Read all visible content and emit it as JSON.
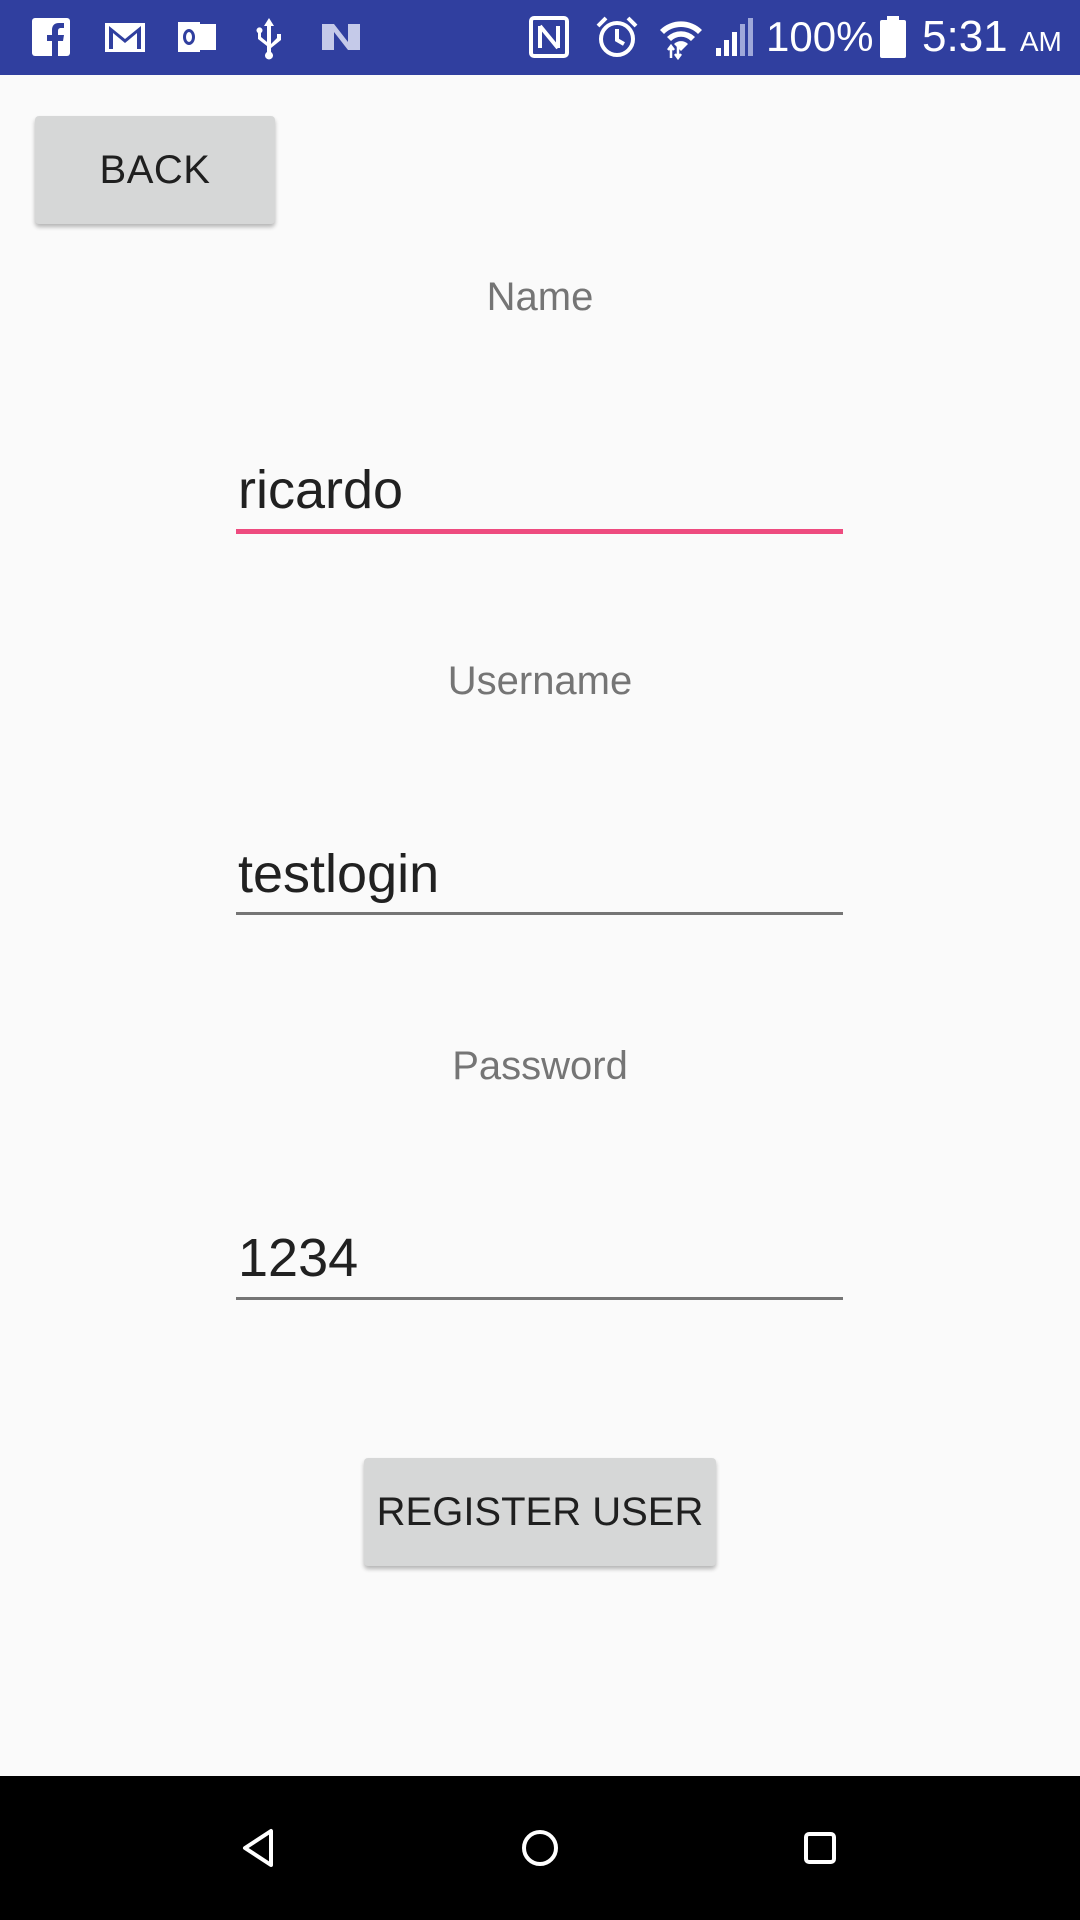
{
  "status_bar": {
    "battery_percent": "100%",
    "time": "5:31",
    "ampm": "AM",
    "background_color": "#303f9f",
    "left_icons": [
      "facebook-icon",
      "gmail-icon",
      "outlook-icon",
      "usb-icon",
      "n-app-icon"
    ],
    "right_icons": [
      "nfc-icon",
      "alarm-icon",
      "wifi-icon",
      "signal-icon",
      "battery-icon"
    ]
  },
  "header": {
    "back_label": "BACK"
  },
  "form": {
    "name": {
      "label": "Name",
      "value": "ricardo"
    },
    "username": {
      "label": "Username",
      "value": "testlogin"
    },
    "password": {
      "label": "Password",
      "value": "1234"
    },
    "active_underline_color": "#ee4b7f",
    "register_label": "REGISTER USER"
  },
  "nav_bar": {
    "icons": [
      "back-triangle-icon",
      "home-circle-icon",
      "recents-square-icon"
    ]
  }
}
